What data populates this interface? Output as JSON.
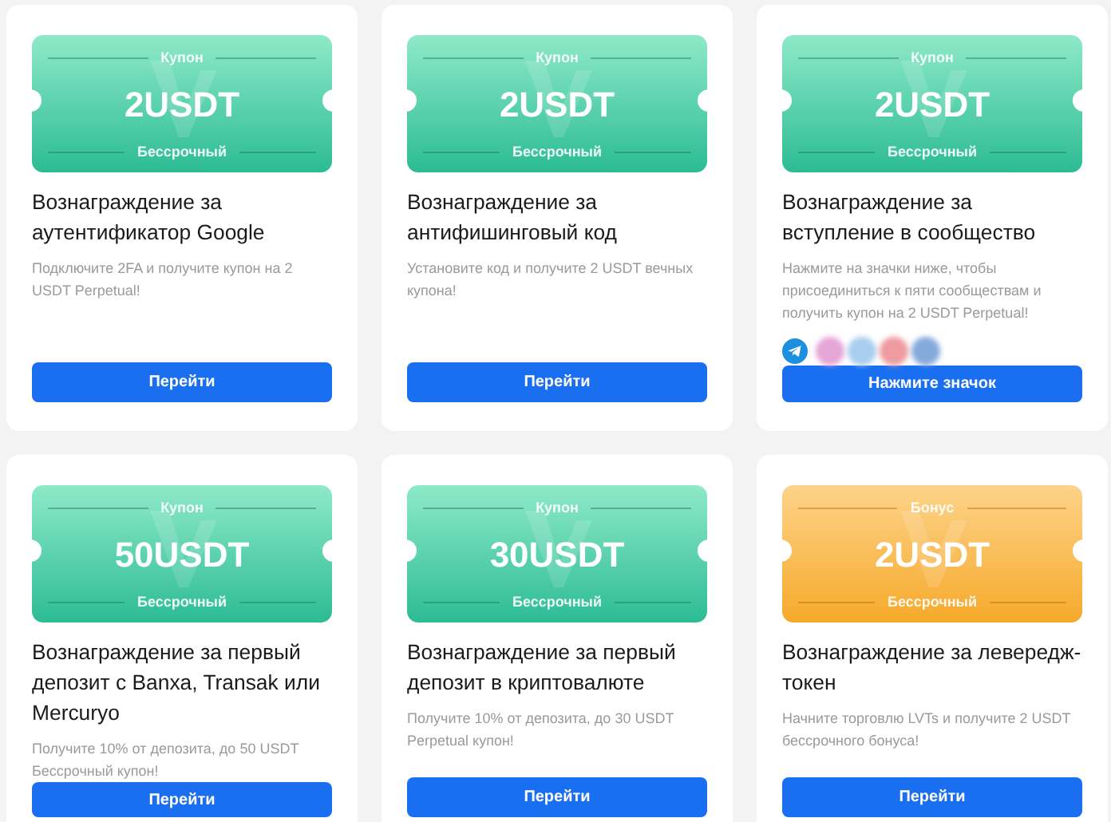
{
  "cards": [
    {
      "ticket": {
        "kind": "coupon",
        "label": "Купон",
        "amount": "2USDT",
        "term": "Бессрочный"
      },
      "title": "Вознаграждение за аутентификатор Google",
      "description": "Подключите 2FA и получите купон на 2 USDT Perpetual!",
      "button": "Перейти"
    },
    {
      "ticket": {
        "kind": "coupon",
        "label": "Купон",
        "amount": "2USDT",
        "term": "Бессрочный"
      },
      "title": "Вознаграждение за антифишинговый код",
      "description": "Установите код и получите 2 USDT вечных купона!",
      "button": "Перейти"
    },
    {
      "ticket": {
        "kind": "coupon",
        "label": "Купон",
        "amount": "2USDT",
        "term": "Бессрочный"
      },
      "title": "Вознаграждение за вступление в сообщество",
      "description": "Нажмите на значки ниже, чтобы присоединиться к пяти сообществам и получить купон на 2 USDT Perpetual!",
      "socials": [
        {
          "kind": "telegram",
          "color": "#1d8fe1"
        },
        {
          "kind": "blurred",
          "color": "#e6a6d6"
        },
        {
          "kind": "blurred",
          "color": "#a8cdee"
        },
        {
          "kind": "blurred",
          "color": "#ee9a9e"
        },
        {
          "kind": "blurred",
          "color": "#86a9dc"
        }
      ],
      "button": "Нажмите значок"
    },
    {
      "ticket": {
        "kind": "coupon",
        "label": "Купон",
        "amount": "50USDT",
        "term": "Бессрочный"
      },
      "title": "Вознаграждение за первый депозит с Banxa, Transak или Mercuryo",
      "description": "Получите 10% от депозита, до 50 USDT Бессрочный купон!",
      "button": "Перейти"
    },
    {
      "ticket": {
        "kind": "coupon",
        "label": "Купон",
        "amount": "30USDT",
        "term": "Бессрочный"
      },
      "title": "Вознаграждение за первый депозит в криптовалюте",
      "description": "Получите 10% от депозита, до 30 USDT Perpetual купон!",
      "button": "Перейти"
    },
    {
      "ticket": {
        "kind": "bonus",
        "label": "Бонус",
        "amount": "2USDT",
        "term": "Бессрочный"
      },
      "title": "Вознаграждение за левередж-токен",
      "description": "Начните торговлю LVTs и получите 2 USDT бессрочного бонуса!",
      "button": "Перейти"
    }
  ]
}
